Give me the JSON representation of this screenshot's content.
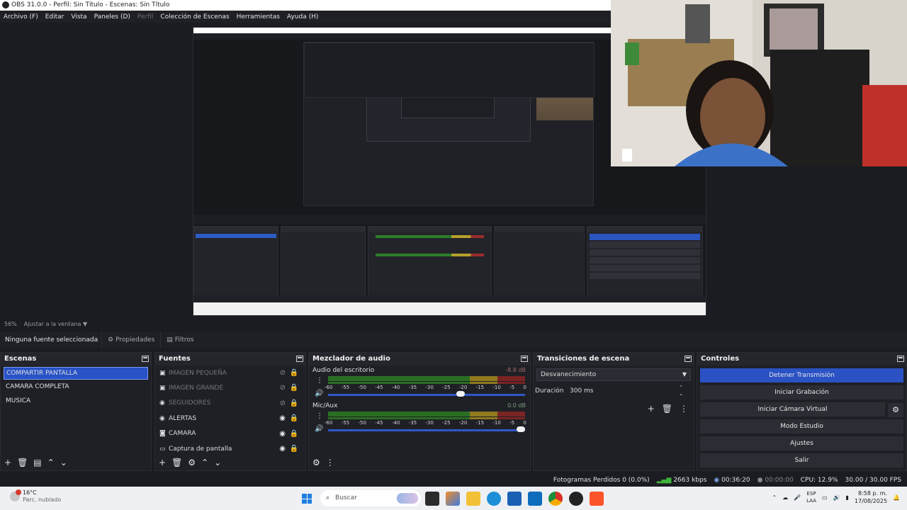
{
  "window": {
    "title": "OBS 31.0.0 - Perfil: Sin Título - Escenas: Sin Título"
  },
  "menu": [
    {
      "label": "Archivo (F)",
      "enabled": true
    },
    {
      "label": "Editar",
      "enabled": true
    },
    {
      "label": "Vista",
      "enabled": true
    },
    {
      "label": "Paneles (D)",
      "enabled": true
    },
    {
      "label": "Perfil",
      "enabled": false
    },
    {
      "label": "Colección de Escenas",
      "enabled": true
    },
    {
      "label": "Herramientas",
      "enabled": true
    },
    {
      "label": "Ayuda (H)",
      "enabled": true
    }
  ],
  "preview": {
    "zoom": "56%",
    "fit": "Ajustar a la ventana"
  },
  "properties_bar": {
    "no_source": "Ninguna fuente seleccionada",
    "properties_tab": "Propiedades",
    "filters_tab": "Filtros"
  },
  "scenes": {
    "title": "Escenas",
    "items": [
      "COMPARTIR PANTALLA",
      "CAMARA COMPLETA",
      "MUSICA"
    ],
    "active_index": 0
  },
  "sources": {
    "title": "Fuentes",
    "items": [
      {
        "label": "IMAGEN PEQUEÑA",
        "icon": "image-icon",
        "visible": false
      },
      {
        "label": "IMAGEN GRANDE",
        "icon": "image-icon",
        "visible": false
      },
      {
        "label": "SEGUIDORES",
        "icon": "browser-icon",
        "visible": false
      },
      {
        "label": "ALERTAS",
        "icon": "browser-icon",
        "visible": true
      },
      {
        "label": "CAMARA",
        "icon": "camera-icon",
        "visible": true
      },
      {
        "label": "Captura de pantalla",
        "icon": "monitor-icon",
        "visible": true
      }
    ]
  },
  "mixer": {
    "title": "Mezclador de audio",
    "channels": [
      {
        "name": "Audio del escritorio",
        "db": "-8.8 dB",
        "level": 0.8,
        "volume": 0.68
      },
      {
        "name": "Mic/Aux",
        "db": "0.0 dB",
        "level": 0.75,
        "volume": 1.0
      }
    ],
    "ticks": [
      "-60",
      "-55",
      "-50",
      "-45",
      "-40",
      "-35",
      "-30",
      "-25",
      "-20",
      "-15",
      "-10",
      "-5",
      "0"
    ]
  },
  "transitions": {
    "title": "Transiciones de escena",
    "selected": "Desvanecimiento",
    "duration_label": "Duración",
    "duration_value": "300 ms"
  },
  "controls": {
    "title": "Controles",
    "buttons": [
      "Detener Transmisión",
      "Iniciar Grabación",
      "Iniciar Cámara Virtual",
      "Modo Estudio",
      "Ajustes",
      "Salir"
    ]
  },
  "statusbar": {
    "dropped": "Fotogramas Perdidos 0 (0.0%)",
    "bitrate": "2663 kbps",
    "stream_time": "00:36:20",
    "rec_time": "00:00:00",
    "cpu": "CPU: 12.9%",
    "fps": "30.00 / 30.00 FPS"
  },
  "taskbar": {
    "weather_temp": "16°C",
    "weather_desc": "Parc. nublado",
    "search_placeholder": "Buscar",
    "lang_top": "ESP",
    "lang_bottom": "LAA",
    "time": "8:58 p. m.",
    "date": "17/08/2025"
  },
  "colors": {
    "accent": "#2852c5",
    "bg": "#1f2026",
    "meter_green": "#2a6e24",
    "meter_yellow": "#8f7a1e",
    "meter_red": "#7a2424"
  }
}
